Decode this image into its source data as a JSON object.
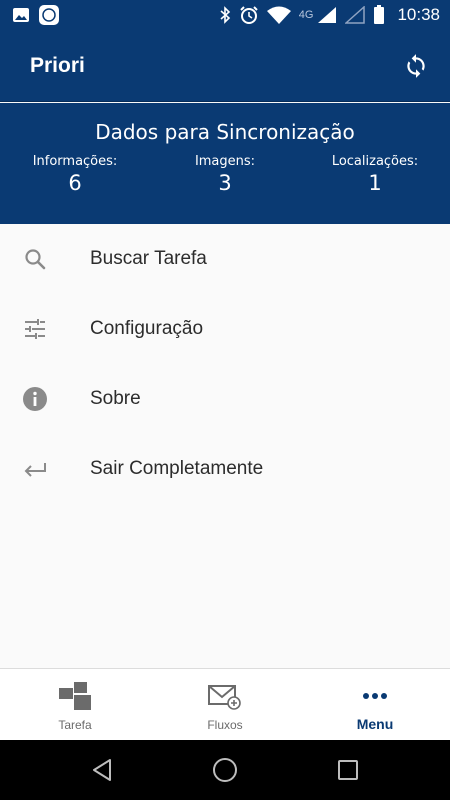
{
  "status_bar": {
    "time": "10:38",
    "network": "4G",
    "icons": [
      "image-icon",
      "app-notification-icon",
      "bluetooth-icon",
      "alarm-icon",
      "wifi-icon",
      "signal-icon",
      "signal-empty-icon",
      "battery-icon"
    ]
  },
  "app_bar": {
    "title": "Priori",
    "sync_icon": "sync-icon"
  },
  "sync_panel": {
    "title": "Dados para Sincronização",
    "stats": [
      {
        "label": "Informações:",
        "value": "6"
      },
      {
        "label": "Imagens:",
        "value": "3"
      },
      {
        "label": "Localizações:",
        "value": "1"
      }
    ]
  },
  "menu": {
    "items": [
      {
        "label": "Buscar Tarefa",
        "icon": "search-icon"
      },
      {
        "label": "Configuração",
        "icon": "sliders-icon"
      },
      {
        "label": "Sobre",
        "icon": "info-icon"
      },
      {
        "label": "Sair Completamente",
        "icon": "exit-arrow-icon"
      }
    ]
  },
  "bottom_nav": {
    "tabs": [
      {
        "label": "Tarefa",
        "icon": "tasks-icon",
        "active": false
      },
      {
        "label": "Fluxos",
        "icon": "mail-add-icon",
        "active": false
      },
      {
        "label": "Menu",
        "icon": "more-dots-icon",
        "active": true
      }
    ]
  },
  "colors": {
    "primary": "#0a3a73",
    "background": "#fafafa",
    "icon_gray": "#8a8a8a",
    "text": "#2c2c2c"
  }
}
